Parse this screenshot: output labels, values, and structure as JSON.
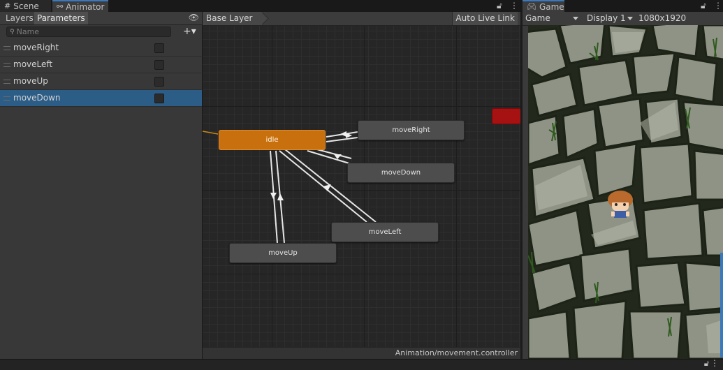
{
  "tabs": {
    "scene": "Scene",
    "animator": "Animator",
    "game": "Game",
    "scene_icon": "grid-icon",
    "animator_icon": "animator-icon",
    "game_icon": "gamepad-icon"
  },
  "parameters_panel": {
    "tab_layers": "Layers",
    "tab_parameters": "Parameters",
    "search_placeholder": "Name",
    "add_label": "+▾",
    "items": [
      {
        "name": "moveRight",
        "value": false,
        "selected": false
      },
      {
        "name": "moveLeft",
        "value": false,
        "selected": false
      },
      {
        "name": "moveUp",
        "value": false,
        "selected": false
      },
      {
        "name": "moveDown",
        "value": false,
        "selected": true
      }
    ]
  },
  "animator": {
    "breadcrumb": "Base Layer",
    "auto_live_link": "Auto Live Link",
    "footer_path": "Animation/movement.controller",
    "states": {
      "idle": "idle",
      "moveRight": "moveRight",
      "moveDown": "moveDown",
      "moveLeft": "moveLeft",
      "moveUp": "moveUp"
    },
    "colors": {
      "default_state": "#c9700e",
      "state": "#4d4d4d",
      "any_state": "#a61111",
      "transition": "#e6e6e6",
      "entry_transition": "#c98a18"
    }
  },
  "game": {
    "display_mode": "Game",
    "display": "Display 1",
    "resolution": "1080x1920"
  }
}
